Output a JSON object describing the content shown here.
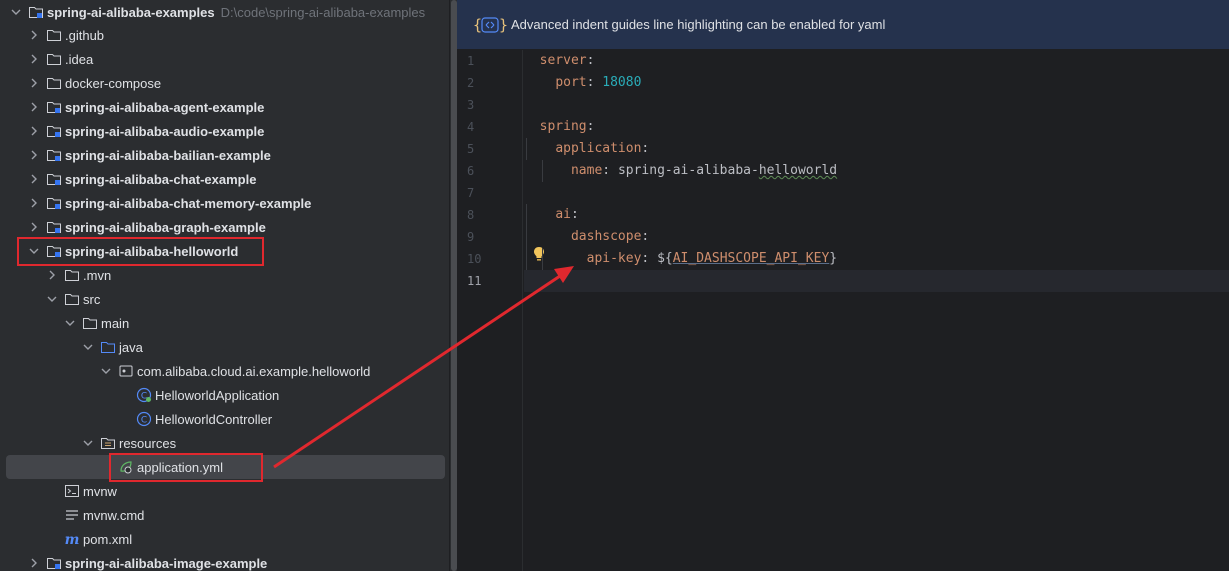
{
  "project_tree": {
    "root": {
      "label": "spring-ai-alibaba-examples",
      "path": "D:\\code\\spring-ai-alibaba-examples"
    },
    "items": [
      {
        "label": ".github",
        "bold": false
      },
      {
        "label": ".idea",
        "bold": false
      },
      {
        "label": "docker-compose",
        "bold": false
      },
      {
        "label": "spring-ai-alibaba-agent-example",
        "bold": true
      },
      {
        "label": "spring-ai-alibaba-audio-example",
        "bold": true
      },
      {
        "label": "spring-ai-alibaba-bailian-example",
        "bold": true
      },
      {
        "label": "spring-ai-alibaba-chat-example",
        "bold": true
      },
      {
        "label": "spring-ai-alibaba-chat-memory-example",
        "bold": true
      },
      {
        "label": "spring-ai-alibaba-graph-example",
        "bold": true
      },
      {
        "label": "spring-ai-alibaba-helloworld",
        "bold": true
      },
      {
        "label": ".mvn",
        "bold": false
      },
      {
        "label": "src",
        "bold": false
      },
      {
        "label": "main",
        "bold": false
      },
      {
        "label": "java",
        "bold": false
      },
      {
        "label": "com.alibaba.cloud.ai.example.helloworld",
        "bold": false
      },
      {
        "label": "HelloworldApplication",
        "bold": false
      },
      {
        "label": "HelloworldController",
        "bold": false
      },
      {
        "label": "resources",
        "bold": false
      },
      {
        "label": "application.yml",
        "bold": false
      },
      {
        "label": "mvnw",
        "bold": false
      },
      {
        "label": "mvnw.cmd",
        "bold": false
      },
      {
        "label": "pom.xml",
        "bold": false
      },
      {
        "label": "spring-ai-alibaba-image-example",
        "bold": true
      }
    ]
  },
  "editor": {
    "notification": "Advanced indent guides line highlighting can be enabled for yaml",
    "line_numbers": [
      "1",
      "2",
      "3",
      "4",
      "5",
      "6",
      "7",
      "8",
      "9",
      "10",
      "11"
    ],
    "code": {
      "l1_key": "server",
      "l2_key": "port",
      "l2_value": "18080",
      "l4_key": "spring",
      "l5_key": "application",
      "l6_key": "name",
      "l6_value_a": "spring-ai-alibaba-",
      "l6_value_b": "helloworld",
      "l8_key": "ai",
      "l9_key": "dashscope",
      "l10_key": "api-key",
      "l10_value_prefix": "${",
      "l10_env": "AI_DASHSCOPE_API_KEY",
      "l10_value_suffix": "}"
    }
  },
  "colors": {
    "annotation_red": "#e0282e",
    "yaml_key": "#cf8e6d",
    "number": "#2aacb8",
    "notification_bg": "#25324d"
  }
}
